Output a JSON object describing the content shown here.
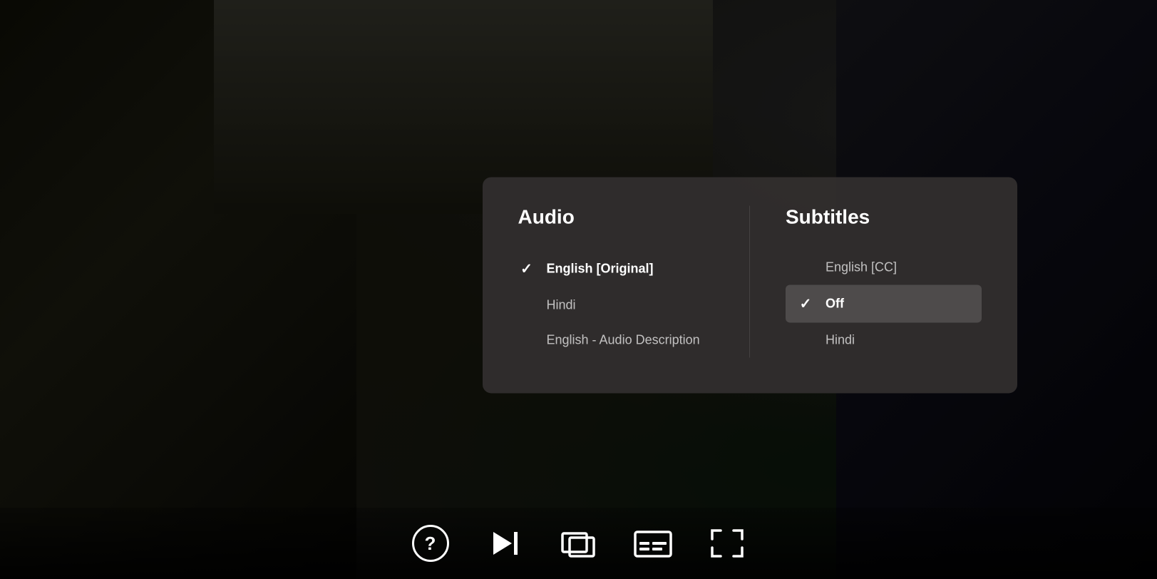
{
  "panel": {
    "audio": {
      "header": "Audio",
      "items": [
        {
          "id": "english-original",
          "label": "English [Original]",
          "selected": true
        },
        {
          "id": "hindi",
          "label": "Hindi",
          "selected": false
        },
        {
          "id": "english-ad",
          "label": "English - Audio Description",
          "selected": false
        }
      ]
    },
    "subtitles": {
      "header": "Subtitles",
      "items": [
        {
          "id": "english-cc",
          "label": "English [CC]",
          "selected": false
        },
        {
          "id": "off",
          "label": "Off",
          "selected": true
        },
        {
          "id": "hindi",
          "label": "Hindi",
          "selected": false
        }
      ]
    }
  },
  "controls": {
    "help_label": "?",
    "skip_next_symbol": "⏭",
    "icons": {
      "help": "question-mark",
      "skip": "skip-next",
      "episodes": "queue",
      "subtitles": "subtitles",
      "fullscreen": "fullscreen"
    }
  }
}
